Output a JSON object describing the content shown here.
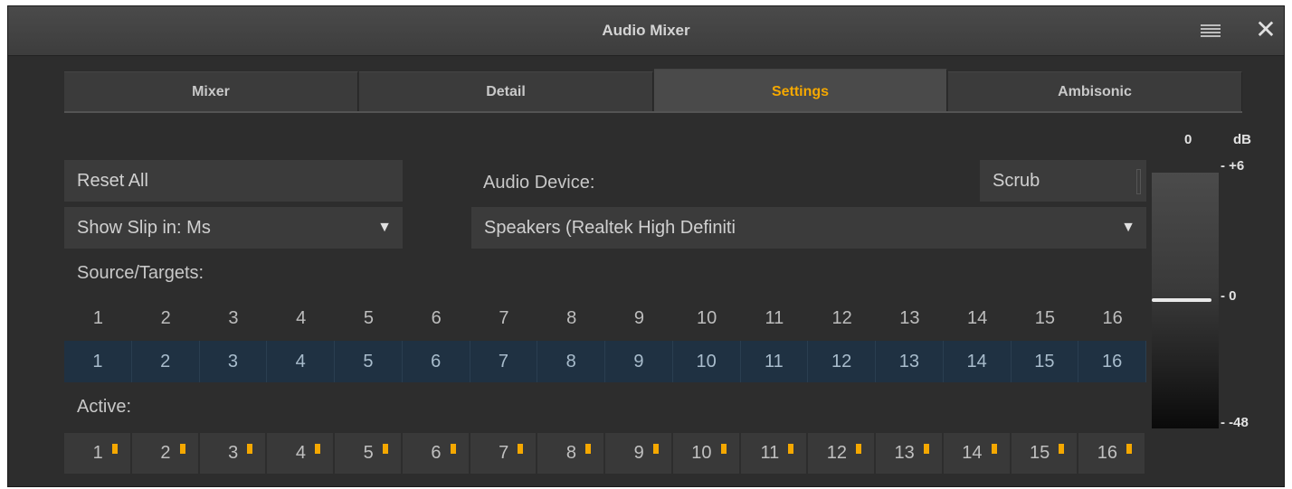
{
  "window": {
    "title": "Audio Mixer"
  },
  "tabs": [
    {
      "label": "Mixer",
      "active": false
    },
    {
      "label": "Detail",
      "active": false
    },
    {
      "label": "Settings",
      "active": true
    },
    {
      "label": "Ambisonic",
      "active": false
    }
  ],
  "settings": {
    "reset_all": "Reset All",
    "show_slip": "Show Slip in: Ms",
    "audio_device_label": "Audio Device:",
    "scrub": "Scrub",
    "audio_device_value": "Speakers (Realtek High Definiti",
    "source_targets_label": "Source/Targets:",
    "active_label": "Active:"
  },
  "sources": [
    "1",
    "2",
    "3",
    "4",
    "5",
    "6",
    "7",
    "8",
    "9",
    "10",
    "11",
    "12",
    "13",
    "14",
    "15",
    "16"
  ],
  "targets": [
    "1",
    "2",
    "3",
    "4",
    "5",
    "6",
    "7",
    "8",
    "9",
    "10",
    "11",
    "12",
    "13",
    "14",
    "15",
    "16"
  ],
  "active": [
    "1",
    "2",
    "3",
    "4",
    "5",
    "6",
    "7",
    "8",
    "9",
    "10",
    "11",
    "12",
    "13",
    "14",
    "15",
    "16"
  ],
  "meter": {
    "header_value": "0",
    "unit": "dB",
    "ticks": [
      "- +6",
      "- 0",
      "- -48"
    ],
    "level_db": 0
  },
  "colors": {
    "accent": "#f5a800",
    "target_row": "#1f3142",
    "background": "#2d2d2d"
  },
  "icons": {
    "menu": "hamburger-menu-icon",
    "close": "close-icon",
    "dropdown": "dropdown-arrow-icon"
  }
}
